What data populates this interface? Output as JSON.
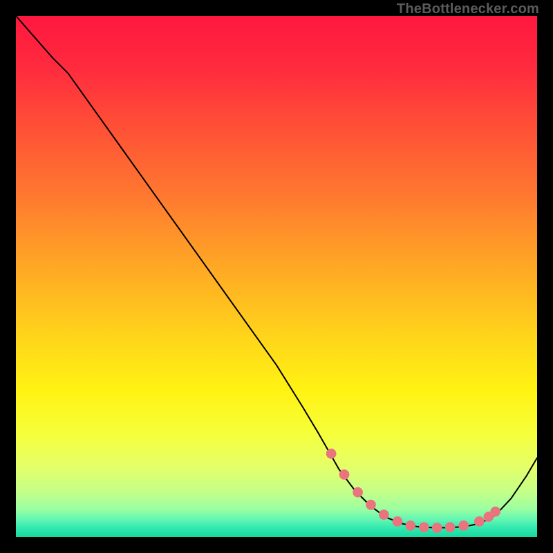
{
  "watermark": "TheBottlenecker.com",
  "colors": {
    "black": "#000000",
    "line": "#000000",
    "dot_fill": "#e9747e",
    "dot_stroke": "#e9747e",
    "gradient_stops": [
      {
        "offset": 0.0,
        "color": "#ff173f"
      },
      {
        "offset": 0.1,
        "color": "#ff2b3e"
      },
      {
        "offset": 0.22,
        "color": "#ff5236"
      },
      {
        "offset": 0.35,
        "color": "#ff7a2f"
      },
      {
        "offset": 0.5,
        "color": "#ffae23"
      },
      {
        "offset": 0.62,
        "color": "#ffd61a"
      },
      {
        "offset": 0.72,
        "color": "#fff313"
      },
      {
        "offset": 0.8,
        "color": "#f6ff3a"
      },
      {
        "offset": 0.86,
        "color": "#e6ff66"
      },
      {
        "offset": 0.91,
        "color": "#c7ff86"
      },
      {
        "offset": 0.945,
        "color": "#9dffa0"
      },
      {
        "offset": 0.965,
        "color": "#66f7b2"
      },
      {
        "offset": 0.982,
        "color": "#33e9b0"
      },
      {
        "offset": 1.0,
        "color": "#16d79e"
      }
    ]
  },
  "chart_data": {
    "type": "line",
    "title": "",
    "xlabel": "",
    "ylabel": "",
    "xlim": [
      0,
      100
    ],
    "ylim": [
      0,
      100
    ],
    "series": [
      {
        "name": "curve",
        "x": [
          0,
          7,
          10,
          15,
          20,
          25,
          30,
          35,
          40,
          45,
          50,
          55,
          58,
          62,
          65,
          68,
          71,
          74,
          77,
          80,
          83,
          86,
          89,
          92,
          95,
          98,
          100
        ],
        "y": [
          100,
          92,
          89,
          82,
          75,
          68,
          61,
          54,
          47,
          40,
          33,
          25,
          20,
          13,
          9,
          6,
          3.8,
          2.6,
          2.0,
          1.8,
          1.8,
          2.0,
          2.6,
          4.2,
          7.4,
          11.8,
          15.2
        ]
      }
    ],
    "highlight_points": {
      "name": "optimal-range",
      "x": [
        60.5,
        63.0,
        65.6,
        68.1,
        70.6,
        73.2,
        75.7,
        78.3,
        80.8,
        83.3,
        85.9,
        88.9,
        90.7,
        92.0
      ],
      "y": [
        16.0,
        12.0,
        8.6,
        6.2,
        4.3,
        3.0,
        2.2,
        1.9,
        1.8,
        1.9,
        2.2,
        3.0,
        3.9,
        4.9
      ]
    }
  }
}
